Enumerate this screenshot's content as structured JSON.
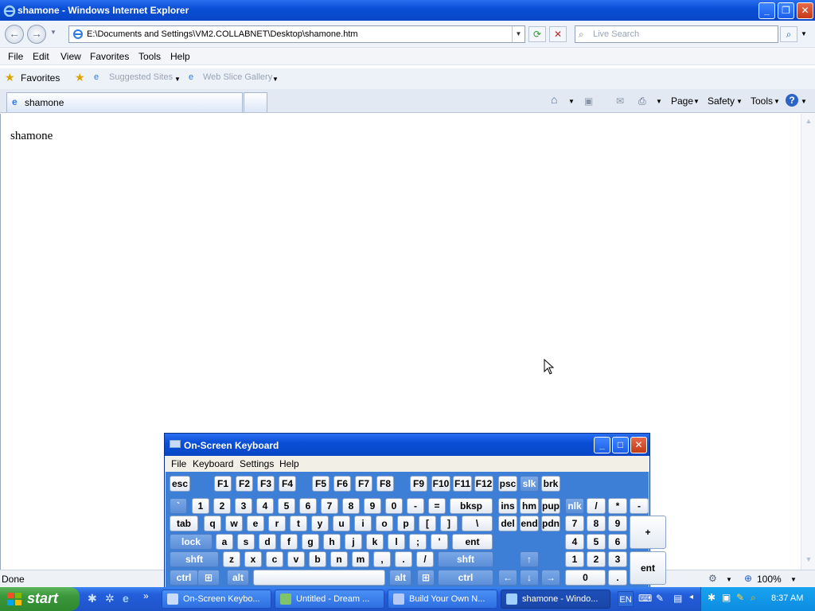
{
  "window": {
    "title": "shamone - Windows Internet Explorer"
  },
  "address_bar": {
    "url": "E:\\Documents and Settings\\VM2.COLLABNET\\Desktop\\shamone.htm",
    "search_placeholder": "Live Search"
  },
  "menu": [
    "File",
    "Edit",
    "View",
    "Favorites",
    "Tools",
    "Help"
  ],
  "favorites_bar": {
    "favorites_label": "Favorites",
    "suggested_sites": "Suggested Sites",
    "web_slice_gallery": "Web Slice Gallery"
  },
  "tabs": [
    {
      "label": "shamone"
    }
  ],
  "command_bar": {
    "page": "Page",
    "safety": "Safety",
    "tools": "Tools"
  },
  "content": {
    "text": "shamone"
  },
  "status": {
    "text": "Done",
    "zoom": "100%"
  },
  "osk": {
    "title": "On-Screen Keyboard",
    "menu": [
      "File",
      "Keyboard",
      "Settings",
      "Help"
    ],
    "row_fn": [
      "esc",
      "F1",
      "F2",
      "F3",
      "F4",
      "F5",
      "F6",
      "F7",
      "F8",
      "F9",
      "F10",
      "F11",
      "F12",
      "psc",
      "slk",
      "brk"
    ],
    "row_num": [
      "`",
      "1",
      "2",
      "3",
      "4",
      "5",
      "6",
      "7",
      "8",
      "9",
      "0",
      "-",
      "=",
      "bksp",
      "ins",
      "hm",
      "pup",
      "nlk",
      "/",
      "*",
      "-"
    ],
    "row_q": [
      "tab",
      "q",
      "w",
      "e",
      "r",
      "t",
      "y",
      "u",
      "i",
      "o",
      "p",
      "[",
      "]",
      "\\",
      "del",
      "end",
      "pdn",
      "7",
      "8",
      "9",
      "+"
    ],
    "row_a": [
      "lock",
      "a",
      "s",
      "d",
      "f",
      "g",
      "h",
      "j",
      "k",
      "l",
      ";",
      "'",
      "ent",
      "4",
      "5",
      "6"
    ],
    "row_z": [
      "shft",
      "z",
      "x",
      "c",
      "v",
      "b",
      "n",
      "m",
      ",",
      ".",
      "/",
      "shft",
      "↑",
      "1",
      "2",
      "3",
      "ent"
    ],
    "row_ctrl": [
      "ctrl",
      "alt",
      "alt",
      "ctrl",
      "←",
      "↓",
      "→",
      "0",
      "."
    ]
  },
  "taskbar": {
    "start": "start",
    "buttons": [
      {
        "label": "On-Screen Keybo..."
      },
      {
        "label": "Untitled - Dream ..."
      },
      {
        "label": "Build Your Own N..."
      },
      {
        "label": "shamone - Windo..."
      }
    ],
    "lang": "EN",
    "clock": "8:37 AM"
  },
  "colors": {
    "xp_blue": "#0a4fd6",
    "start_green": "#3a963a",
    "osk_panel": "#3d7fd7"
  }
}
